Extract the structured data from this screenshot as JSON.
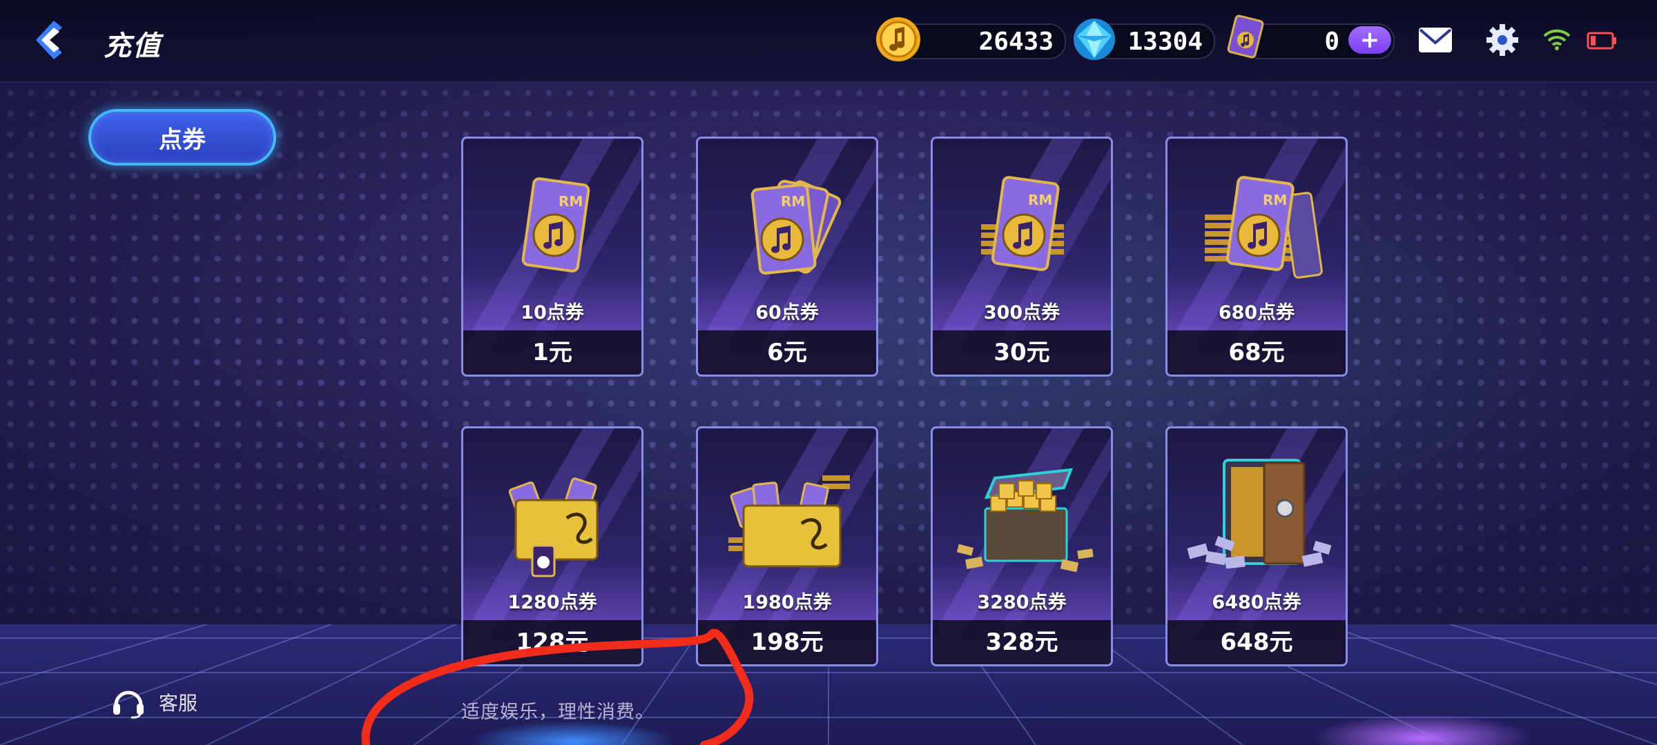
{
  "header": {
    "title": "充值",
    "resources": {
      "coins": "26433",
      "diamonds": "13304",
      "vouchers": "0"
    },
    "plus_label": "+"
  },
  "tabs": [
    {
      "label": "点券",
      "active": true
    }
  ],
  "products": [
    {
      "amount": "10点券",
      "price": "1元",
      "art": "card-single-icon"
    },
    {
      "amount": "60点券",
      "price": "6元",
      "art": "card-fan-icon"
    },
    {
      "amount": "300点券",
      "price": "30元",
      "art": "card-stack-icon"
    },
    {
      "amount": "680点券",
      "price": "68元",
      "art": "card-bigstack-icon"
    },
    {
      "amount": "1280点券",
      "price": "128元",
      "art": "gold-box-icon"
    },
    {
      "amount": "1980点券",
      "price": "198元",
      "art": "gold-box-large-icon"
    },
    {
      "amount": "3280点券",
      "price": "328元",
      "art": "treasure-chest-icon"
    },
    {
      "amount": "6480点券",
      "price": "648元",
      "art": "vault-icon"
    }
  ],
  "footer": {
    "service_label": "客服",
    "notice": "适度娱乐，理性消费。"
  },
  "colors": {
    "accent_blue": "#3fb8ff",
    "plus_purple": "#8a4ff5",
    "annotation_red": "#f22c1b"
  }
}
